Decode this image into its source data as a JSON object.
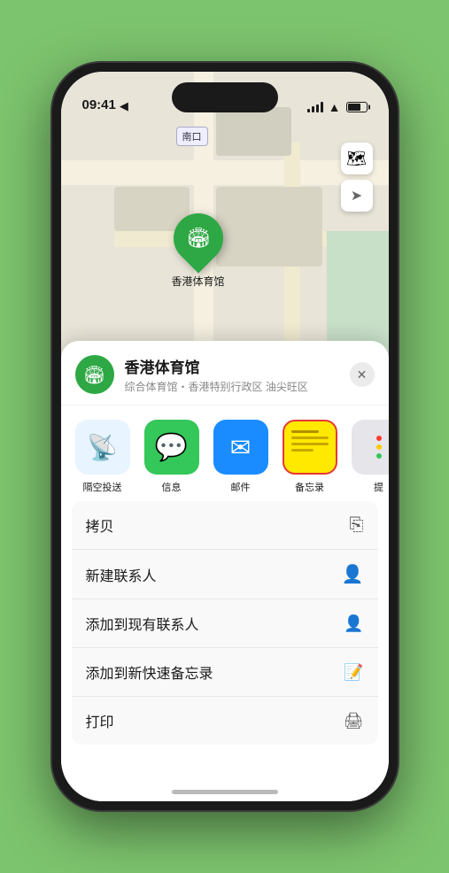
{
  "statusBar": {
    "time": "09:41",
    "locationArrow": "▶"
  },
  "map": {
    "label": "南口",
    "layersBtn": "🗺",
    "locationBtn": "➤"
  },
  "pin": {
    "label": "香港体育馆",
    "emoji": "🏟"
  },
  "sheet": {
    "venueName": "香港体育馆",
    "venueSub": "综合体育馆・香港特别行政区 油尖旺区",
    "closeBtn": "✕"
  },
  "shareItems": [
    {
      "id": "airdrop",
      "label": "隔空投送",
      "emoji": "📡"
    },
    {
      "id": "messages",
      "label": "信息",
      "emoji": "💬"
    },
    {
      "id": "mail",
      "label": "邮件",
      "emoji": "✉"
    },
    {
      "id": "notes",
      "label": "备忘录",
      "emoji": ""
    },
    {
      "id": "more",
      "label": "提",
      "emoji": ""
    }
  ],
  "actionItems": [
    {
      "label": "拷贝",
      "icon": "📋"
    },
    {
      "label": "新建联系人",
      "icon": "👤"
    },
    {
      "label": "添加到现有联系人",
      "icon": "👤"
    },
    {
      "label": "添加到新快速备忘录",
      "icon": "📝"
    },
    {
      "label": "打印",
      "icon": "🖨"
    }
  ],
  "colors": {
    "green": "#2da844",
    "accent": "#e53935"
  }
}
